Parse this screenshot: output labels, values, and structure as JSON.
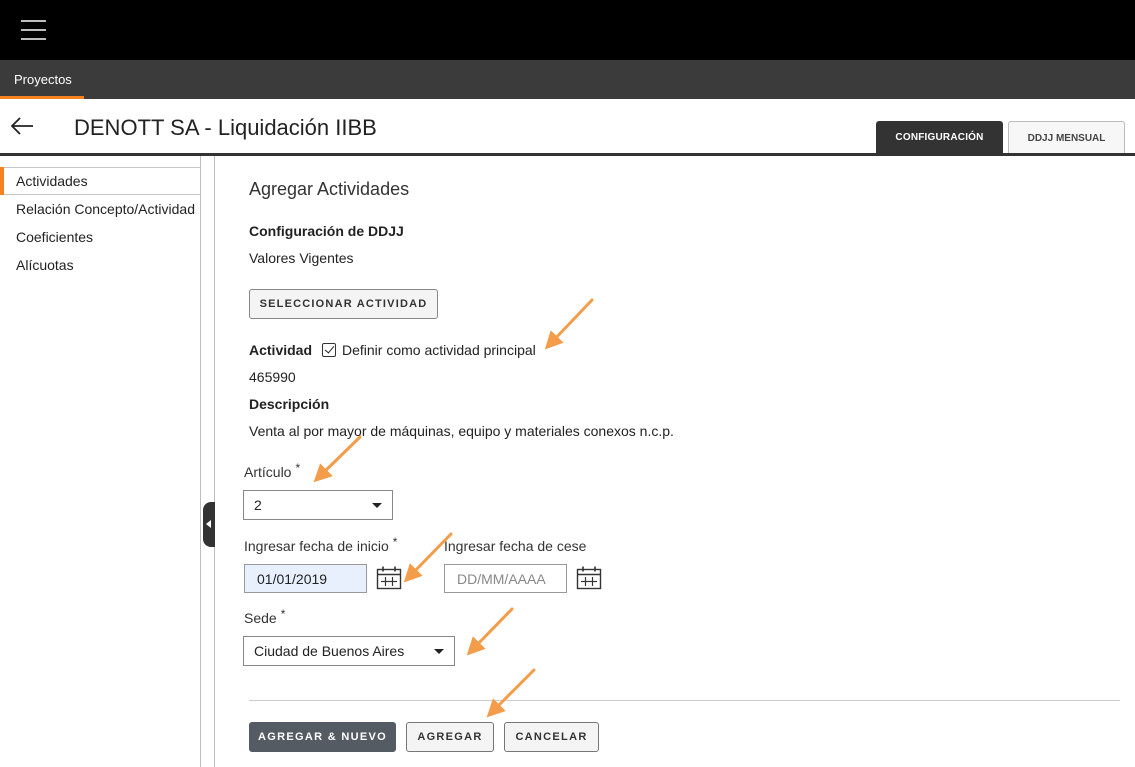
{
  "menu_icon": "hamburger-menu-icon",
  "nav": {
    "projects_tab": "Proyectos"
  },
  "header": {
    "back_icon": "arrow-left-icon",
    "title": "DENOTT SA - Liquidación IIBB",
    "tabs": [
      "CONFIGURACIÓN",
      "DDJJ MENSUAL"
    ],
    "active_tab": "CONFIGURACIÓN"
  },
  "sidebar": {
    "items": [
      {
        "label": "Actividades",
        "active": true
      },
      {
        "label": "Relación Concepto/Actividad",
        "active": false
      },
      {
        "label": "Coeficientes",
        "active": false
      },
      {
        "label": "Alícuotas",
        "active": false
      }
    ]
  },
  "form": {
    "title": "Agregar Actividades",
    "config_label": "Configuración de DDJJ",
    "config_value": "Valores Vigentes",
    "select_activity_button": "SELECCIONAR ACTIVIDAD",
    "activity_label": "Actividad",
    "main_activity_checkbox": {
      "label": "Definir como actividad principal",
      "checked": true
    },
    "activity_code": "465990",
    "description_label": "Descripción",
    "description_value": "Venta al por mayor de máquinas, equipo y materiales conexos n.c.p.",
    "article": {
      "label": "Artículo",
      "required_mark": "*",
      "value": "2"
    },
    "start_date": {
      "label": "Ingresar fecha de inicio",
      "required_mark": "*",
      "value": "01/01/2019"
    },
    "end_date": {
      "label": "Ingresar fecha de cese",
      "placeholder": "DD/MM/AAAA",
      "value": ""
    },
    "site": {
      "label": "Sede",
      "required_mark": "*",
      "value": "Ciudad de Buenos Aires"
    },
    "calendar_icon": "calendar-icon"
  },
  "buttons": {
    "add_and_new": "AGREGAR & NUEVO",
    "add": "AGREGAR",
    "cancel": "CANCELAR"
  },
  "colors": {
    "accent_orange": "#f5821f",
    "annotation_arrow": "#f39c4a",
    "topbar": "#000000",
    "navbar": "#3b3b3b",
    "primary_button": "#555b63",
    "date_input_fill": "#e8f0fe"
  }
}
